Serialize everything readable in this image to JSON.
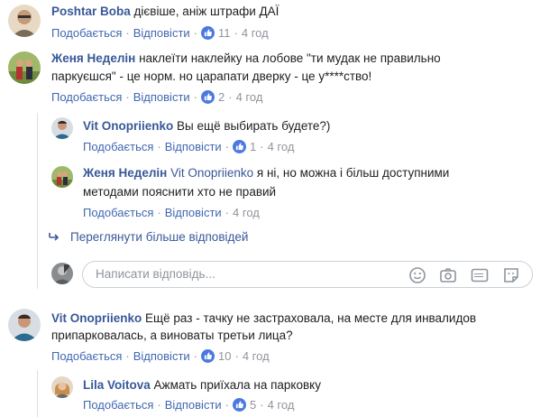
{
  "comments": [
    {
      "author": "Poshtar Boba",
      "text_lines": [
        "дієвіше, аніж штрафи ДАЇ"
      ],
      "like_label": "Подобається",
      "reply_label": "Відповісти",
      "likes": "11",
      "time": "4 год"
    },
    {
      "author": "Женя Неделін",
      "text_lines": [
        "наклеїти наклейку на лобове \"ти мудак не правильно",
        "паркуєшся\" - це норм. но царапати дверку - це у****ство!"
      ],
      "like_label": "Подобається",
      "reply_label": "Відповісти",
      "likes": "2",
      "time": "4 год"
    },
    {
      "author": "Vit Onopriienko",
      "text_lines": [
        "Вы ещё выбирать будете?)"
      ],
      "like_label": "Подобається",
      "reply_label": "Відповісти",
      "likes": "1",
      "time": "4 год"
    },
    {
      "author": "Женя Неделін",
      "mention": "Vit Onopriienko",
      "text_lines": [
        "я ні, но можна і більш доступними",
        "методами пояснити хто не правий"
      ],
      "like_label": "Подобається",
      "reply_label": "Відповісти",
      "time": "4 год"
    },
    {
      "author": "Vit Onopriienko",
      "text_lines": [
        "Ещё раз - тачку не застраховала, на месте для инвалидов",
        "припарковалась, а виноваты третьи лица?"
      ],
      "like_label": "Подобається",
      "reply_label": "Відповісти",
      "likes": "10",
      "time": "4 год"
    },
    {
      "author": "Lila Voitova",
      "text_lines": [
        "Ажмать приїхала на парковку"
      ],
      "like_label": "Подобається",
      "reply_label": "Відповісти",
      "likes": "5",
      "time": "4 год"
    }
  ],
  "more_replies": "Переглянути більше відповідей",
  "reply_input": {
    "placeholder": "Написати відповідь..."
  },
  "colors": {
    "link": "#385898",
    "action": "#4267b2",
    "meta": "#90949c",
    "like": "#4a7ae0"
  },
  "icons": [
    "reply-arrow-icon",
    "emoji-icon",
    "camera-icon",
    "gif-icon",
    "sticker-icon",
    "like-thumb-icon"
  ]
}
